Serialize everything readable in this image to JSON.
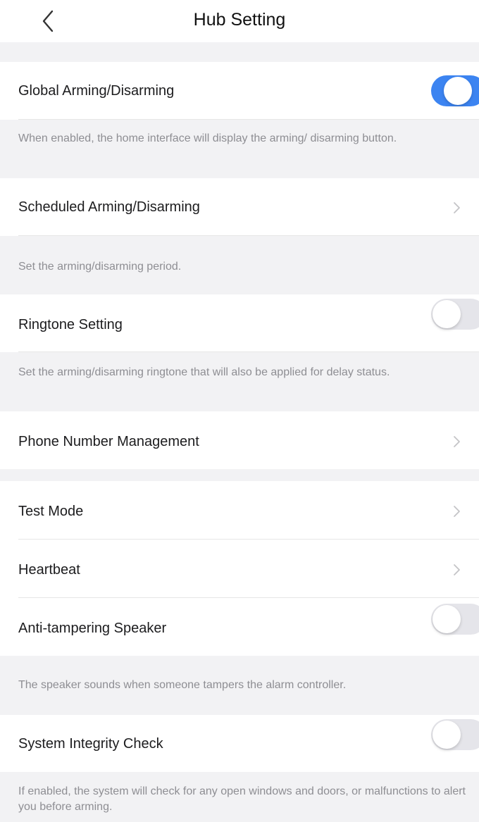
{
  "header": {
    "title": "Hub Setting",
    "back_icon": "chevron-left-icon"
  },
  "settings": {
    "global_arming": {
      "label": "Global Arming/Disarming",
      "enabled": true,
      "note": "When enabled, the home interface will display the arming/ disarming button."
    },
    "scheduled_arming": {
      "label": "Scheduled Arming/Disarming",
      "note": "Set the arming/disarming period."
    },
    "ringtone": {
      "label": "Ringtone Setting",
      "enabled": false,
      "note": "Set the arming/disarming ringtone that will also be applied for delay status."
    },
    "phone_numbers": {
      "label": "Phone Number Management"
    },
    "test_mode": {
      "label": "Test Mode"
    },
    "heartbeat": {
      "label": "Heartbeat"
    },
    "anti_tampering": {
      "label": "Anti-tampering Speaker",
      "enabled": false,
      "note": "The speaker sounds when someone tampers the alarm controller."
    },
    "integrity_check": {
      "label": "System Integrity Check",
      "enabled": false,
      "note": "If enabled, the system will check for any open windows and doors, or malfunctions to alert you before arming."
    }
  },
  "colors": {
    "accent": "#3c84f1",
    "background": "#f2f2f4",
    "note_text": "#8e8e93",
    "toggle_off": "#e5e5ea"
  }
}
